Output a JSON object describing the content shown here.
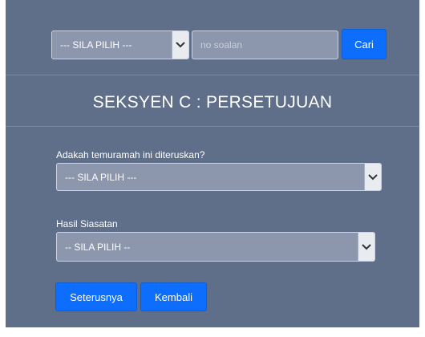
{
  "search": {
    "select_value": "--- SILA PILIH ---",
    "input_placeholder": "no soalan",
    "input_value": "",
    "button_label": "Cari"
  },
  "section": {
    "title": "SEKSYEN C : PERSETUJUAN"
  },
  "form": {
    "question1": {
      "label": "Adakah temuramah ini diteruskan?",
      "select_value": "--- SILA PILIH ---"
    },
    "question2": {
      "label": "Hasil Siasatan",
      "select_value": "-- SILA PILIH --"
    }
  },
  "actions": {
    "next_label": "Seterusnya",
    "back_label": "Kembali"
  },
  "colors": {
    "panel_bg": "#5f6f8a",
    "field_bg": "#8c97ad",
    "button_blue": "#0d6efd"
  }
}
